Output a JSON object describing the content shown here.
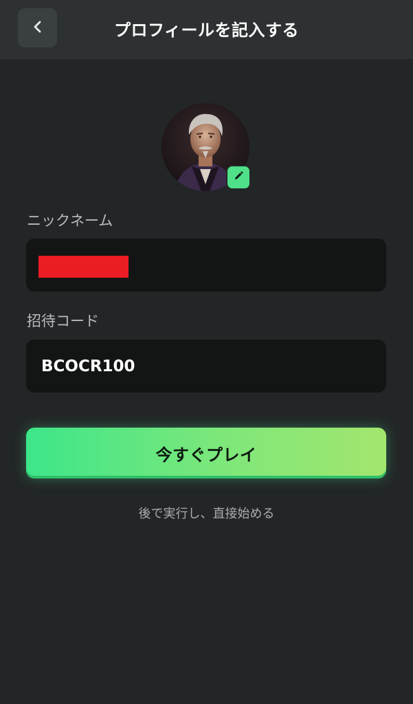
{
  "header": {
    "title": "プロフィールを記入する",
    "back_icon": "chevron-left-icon"
  },
  "avatar": {
    "edit_icon": "pencil-icon",
    "accent_color": "#4fe089"
  },
  "form": {
    "nickname_label": "ニックネーム",
    "nickname_value": "",
    "invite_label": "招待コード",
    "invite_value": "BCOCR100"
  },
  "actions": {
    "play_label": "今すぐプレイ",
    "skip_label": "後で実行し、直接始める"
  },
  "colors": {
    "background": "#232627",
    "header": "#2d3132",
    "field": "#131515",
    "primary_start": "#3de68a",
    "primary_end": "#a3e66d"
  }
}
